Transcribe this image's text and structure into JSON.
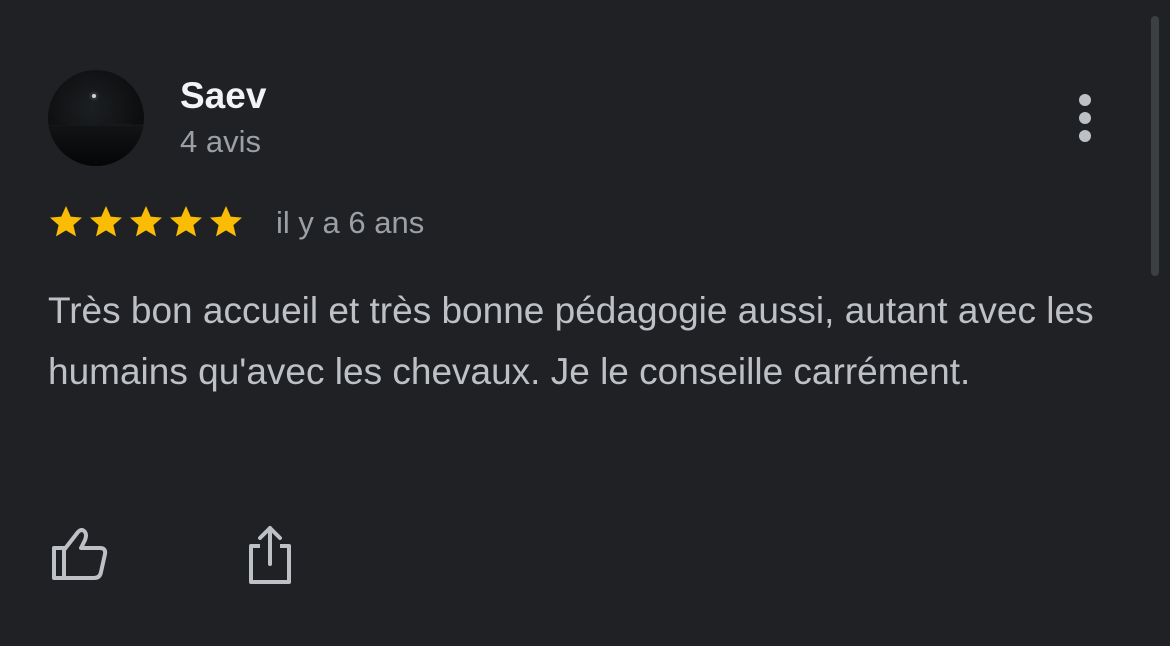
{
  "review": {
    "author": {
      "name": "Saev",
      "meta": "4 avis",
      "avatar_icon": "avatar-night-photo"
    },
    "rating": {
      "stars": 5,
      "max_stars": 5,
      "star_color": "#fbbc04"
    },
    "date": "il y a 6 ans",
    "text": "Très bon accueil et très bonne pédagogie aussi, autant avec les humains qu'avec les chevaux. Je le conseille carrément.",
    "actions": {
      "more_icon": "more-vert-icon",
      "like_icon": "thumb-up-icon",
      "share_icon": "share-icon"
    }
  },
  "theme": {
    "background": "#202124",
    "primary_text": "#f1f3f4",
    "secondary_text": "#9aa0a6",
    "body_text": "#bdc1c6"
  }
}
